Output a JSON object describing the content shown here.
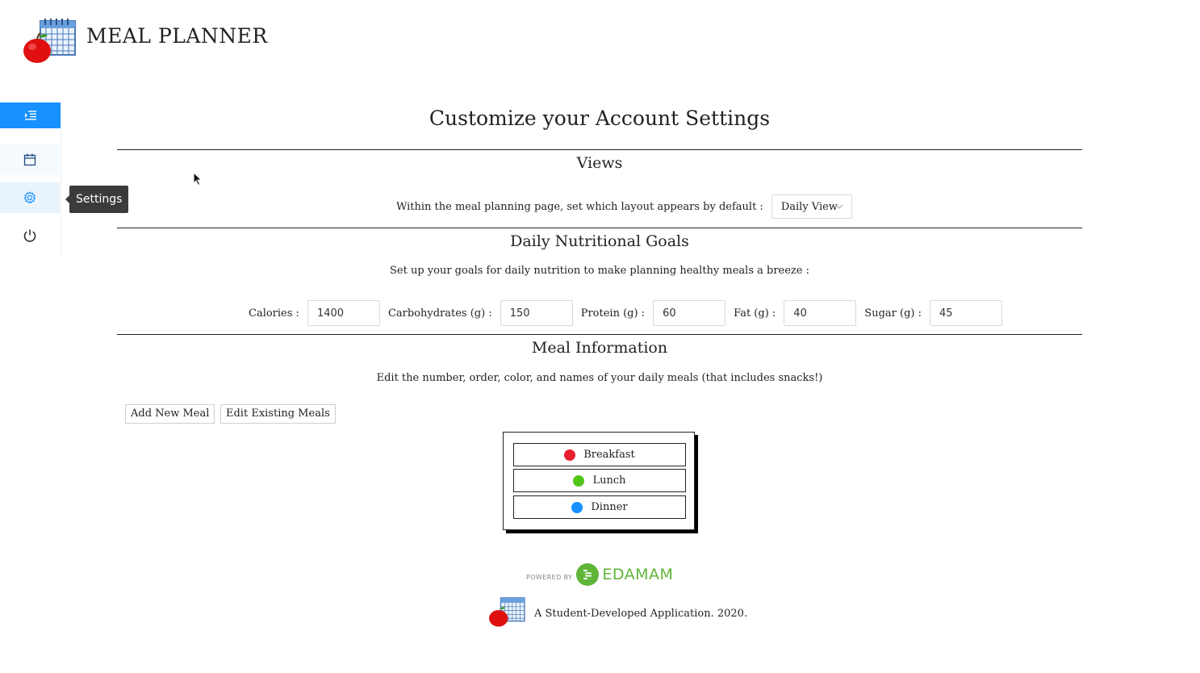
{
  "header": {
    "app_title": "MEAL PLANNER"
  },
  "sidebar": {
    "items": [
      {
        "icon": "menu-fold-icon"
      },
      {
        "icon": "calendar-icon"
      },
      {
        "icon": "gear-icon",
        "tooltip": "Settings"
      },
      {
        "icon": "power-icon"
      }
    ]
  },
  "main": {
    "title": "Customize your Account Settings",
    "views": {
      "title": "Views",
      "description": "Within the meal planning page, set which layout appears by default :",
      "selected_view": "Daily View"
    },
    "goals": {
      "title": "Daily Nutritional Goals",
      "description": "Set up your goals for daily nutrition to make planning healthy meals a breeze :",
      "fields": [
        {
          "label": "Calories :",
          "value": "1400"
        },
        {
          "label": "Carbohydrates (g) :",
          "value": "150"
        },
        {
          "label": "Protein (g) :",
          "value": "60"
        },
        {
          "label": "Fat (g) :",
          "value": "40"
        },
        {
          "label": "Sugar (g) :",
          "value": "45"
        }
      ]
    },
    "meals": {
      "title": "Meal Information",
      "description": "Edit the number, order, color, and names of your daily meals (that includes snacks!)",
      "add_button": "Add New Meal",
      "edit_button": "Edit Existing Meals",
      "items": [
        {
          "name": "Breakfast",
          "color": "#e8202f"
        },
        {
          "name": "Lunch",
          "color": "#52c41a"
        },
        {
          "name": "Dinner",
          "color": "#1890ff"
        }
      ]
    }
  },
  "footer": {
    "powered_by": "POWERED BY",
    "partner": "EDAMAM",
    "credit": "A Student-Developed Application. 2020."
  },
  "colors": {
    "accent": "#1890ff",
    "edamam_green": "#5fb538"
  }
}
